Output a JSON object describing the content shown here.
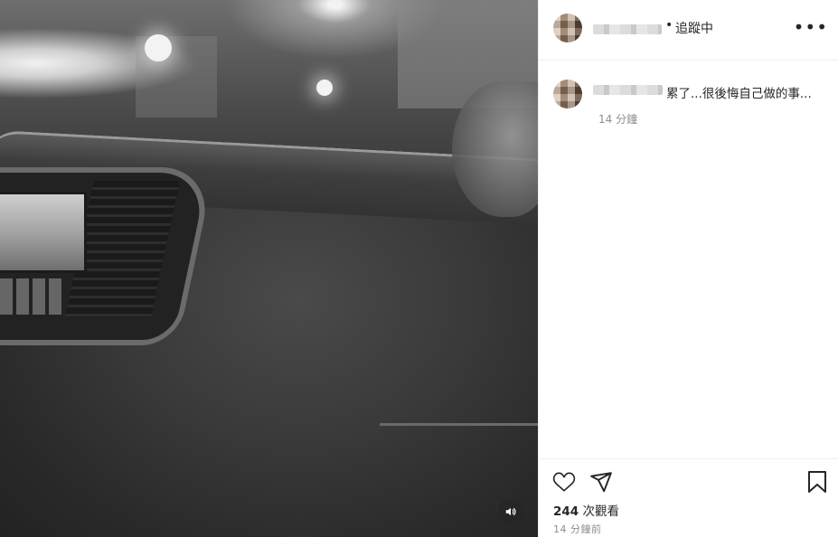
{
  "post": {
    "username": "",
    "follow_separator": "•",
    "follow_status": "追蹤中",
    "more_label": "•••"
  },
  "caption": {
    "username": "",
    "text": "累了...很後悔自己做的事...",
    "time": "14 分鐘"
  },
  "engagement": {
    "view_count": "244",
    "view_label": "次觀看",
    "posted_ago": "14 分鐘前"
  },
  "icons": {
    "like": "heart-icon",
    "share": "paper-plane-icon",
    "save": "bookmark-icon",
    "more": "ellipsis-icon",
    "audio": "speaker-icon"
  },
  "colors": {
    "text": "#262626",
    "muted": "#8e8e8e",
    "divider": "#efefef",
    "media_bg": "#2a2a2a"
  }
}
